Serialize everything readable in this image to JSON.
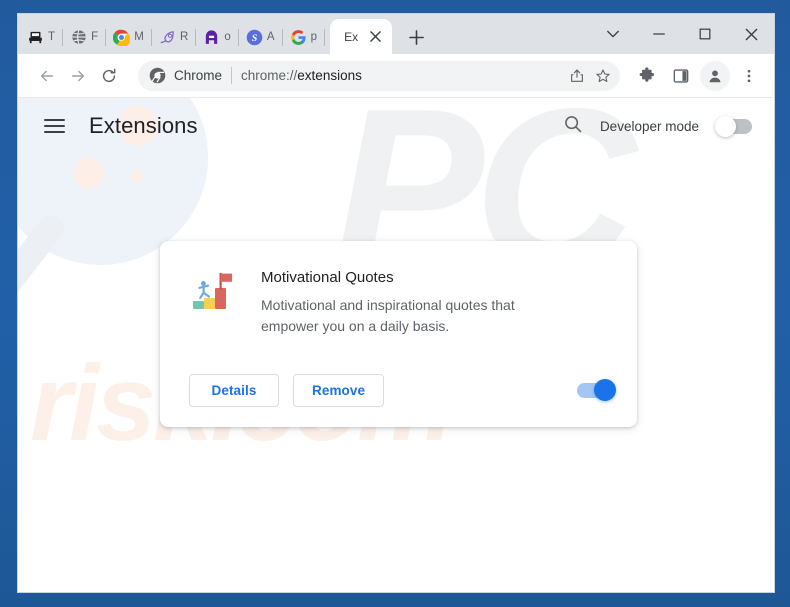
{
  "window": {
    "controls": [
      {
        "name": "tab-search-button",
        "icon": "chevron-down-icon"
      },
      {
        "name": "minimize-button",
        "icon": "minimize-icon"
      },
      {
        "name": "maximize-button",
        "icon": "maximize-icon"
      },
      {
        "name": "close-button",
        "icon": "close-icon"
      }
    ]
  },
  "tabstrip": {
    "mini_tabs": [
      {
        "icon": "printer-icon",
        "title": "T"
      },
      {
        "icon": "globe-icon",
        "title": "F"
      },
      {
        "icon": "chrome-icon",
        "title": "M"
      },
      {
        "icon": "comet-icon",
        "title": "R"
      },
      {
        "icon": "letter-a-icon",
        "title": "o"
      },
      {
        "icon": "scribd-icon",
        "title": "A"
      },
      {
        "icon": "google-icon",
        "title": "p"
      }
    ],
    "active_tab": {
      "label": "Ex",
      "close_icon": "close-icon"
    },
    "new_tab_label": "+"
  },
  "toolbar": {
    "back_icon": "back-arrow-icon",
    "forward_icon": "forward-arrow-icon",
    "reload_icon": "reload-icon",
    "omnibox": {
      "site_icon": "chrome-icon",
      "source": "Chrome",
      "url_prefix": "chrome://",
      "url_emphasis": "extensions",
      "share_icon": "share-icon",
      "bookmark_icon": "star-icon"
    },
    "extensions_icon": "puzzle-piece-icon",
    "sidepanel_icon": "side-panel-icon",
    "profile_icon": "account-avatar-icon",
    "menu_icon": "three-dots-menu-icon"
  },
  "extensions_page": {
    "menu_icon": "hamburger-menu-icon",
    "title": "Extensions",
    "search_icon": "search-icon",
    "developer_mode_label": "Developer mode",
    "developer_mode_on": false,
    "card": {
      "icon_name": "motivational-quotes-extension-icon",
      "name": "Motivational Quotes",
      "description": "Motivational and inspirational quotes that empower you on a daily basis.",
      "details_label": "Details",
      "remove_label": "Remove",
      "enabled": true
    }
  },
  "watermark": {
    "mark_top": "PC",
    "mark_bottom": "risk.com"
  },
  "colors": {
    "accent_blue": "#1a73e8",
    "tabstrip_gray": "#dee1e6",
    "frame_blue": "#2160a8",
    "omnibox_gray": "#f1f3f4",
    "text_primary": "#202124",
    "text_secondary": "#5f6368"
  }
}
